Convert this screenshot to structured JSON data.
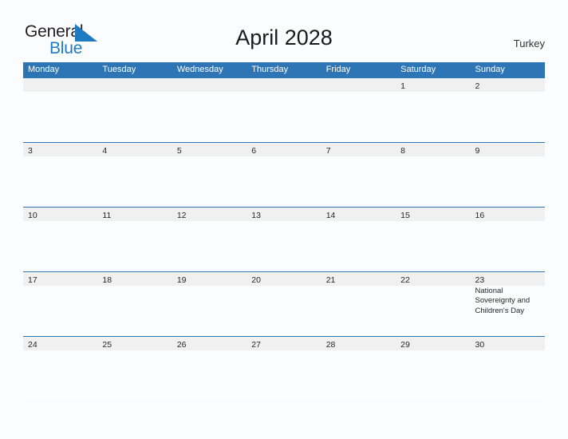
{
  "logo": {
    "word_one": "General",
    "word_two": "Blue",
    "triangle_icon": "blue-triangle-icon",
    "brand_color": "#1f7bc1"
  },
  "header": {
    "title": "April 2028",
    "locale": "Turkey"
  },
  "calendar": {
    "accent_color": "#2e75b6",
    "band_color": "#f0f0f0",
    "weekdays": [
      "Monday",
      "Tuesday",
      "Wednesday",
      "Thursday",
      "Friday",
      "Saturday",
      "Sunday"
    ],
    "weeks": [
      {
        "days": [
          {
            "num": "",
            "event": ""
          },
          {
            "num": "",
            "event": ""
          },
          {
            "num": "",
            "event": ""
          },
          {
            "num": "",
            "event": ""
          },
          {
            "num": "",
            "event": ""
          },
          {
            "num": "1",
            "event": ""
          },
          {
            "num": "2",
            "event": ""
          }
        ]
      },
      {
        "days": [
          {
            "num": "3",
            "event": ""
          },
          {
            "num": "4",
            "event": ""
          },
          {
            "num": "5",
            "event": ""
          },
          {
            "num": "6",
            "event": ""
          },
          {
            "num": "7",
            "event": ""
          },
          {
            "num": "8",
            "event": ""
          },
          {
            "num": "9",
            "event": ""
          }
        ]
      },
      {
        "days": [
          {
            "num": "10",
            "event": ""
          },
          {
            "num": "11",
            "event": ""
          },
          {
            "num": "12",
            "event": ""
          },
          {
            "num": "13",
            "event": ""
          },
          {
            "num": "14",
            "event": ""
          },
          {
            "num": "15",
            "event": ""
          },
          {
            "num": "16",
            "event": ""
          }
        ]
      },
      {
        "days": [
          {
            "num": "17",
            "event": ""
          },
          {
            "num": "18",
            "event": ""
          },
          {
            "num": "19",
            "event": ""
          },
          {
            "num": "20",
            "event": ""
          },
          {
            "num": "21",
            "event": ""
          },
          {
            "num": "22",
            "event": ""
          },
          {
            "num": "23",
            "event": "National Sovereignty and Children's Day"
          }
        ]
      },
      {
        "days": [
          {
            "num": "24",
            "event": ""
          },
          {
            "num": "25",
            "event": ""
          },
          {
            "num": "26",
            "event": ""
          },
          {
            "num": "27",
            "event": ""
          },
          {
            "num": "28",
            "event": ""
          },
          {
            "num": "29",
            "event": ""
          },
          {
            "num": "30",
            "event": ""
          }
        ]
      }
    ]
  }
}
